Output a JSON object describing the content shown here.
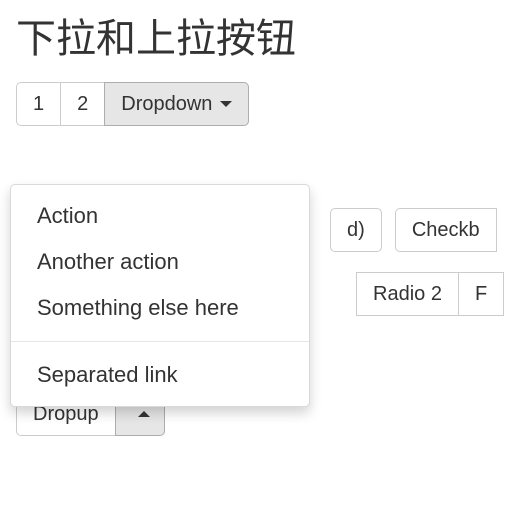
{
  "heading": "下拉和上拉按钮",
  "group1": {
    "btn1": "1",
    "btn2": "2",
    "dropdown_label": "Dropdown"
  },
  "menu": {
    "items": [
      "Action",
      "Another action",
      "Something else here"
    ],
    "separated": "Separated link"
  },
  "row2": {
    "btn_partial": "d)",
    "checkbox_partial": "Checkb"
  },
  "row3": {
    "radio2": "Radio 2",
    "radio_partial": "F"
  },
  "dropup": {
    "label": "Dropup"
  }
}
